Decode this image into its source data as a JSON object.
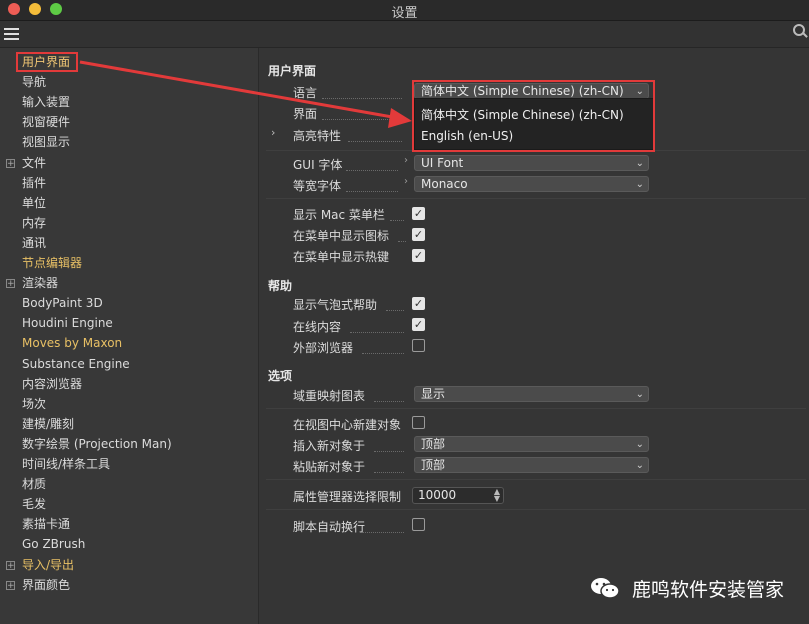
{
  "window": {
    "title": "设置"
  },
  "sidebar": {
    "items": [
      {
        "label": "用户界面",
        "state": "selected"
      },
      {
        "label": "导航"
      },
      {
        "label": "输入装置"
      },
      {
        "label": "视窗硬件"
      },
      {
        "label": "视图显示"
      },
      {
        "label": "文件",
        "expandable": true
      },
      {
        "label": "插件"
      },
      {
        "label": "单位"
      },
      {
        "label": "内存"
      },
      {
        "label": "通讯"
      },
      {
        "label": "节点编辑器",
        "state": "highlight"
      },
      {
        "label": "渲染器",
        "expandable": true
      },
      {
        "label": "BodyPaint 3D"
      },
      {
        "label": "Houdini Engine"
      },
      {
        "label": "Moves by Maxon",
        "state": "highlight"
      },
      {
        "label": "Substance Engine"
      },
      {
        "label": "内容浏览器"
      },
      {
        "label": "场次"
      },
      {
        "label": "建模/雕刻"
      },
      {
        "label": "数字绘景 (Projection Man)"
      },
      {
        "label": "时间线/样条工具"
      },
      {
        "label": "材质"
      },
      {
        "label": "毛发"
      },
      {
        "label": "素描卡通"
      },
      {
        "label": "Go ZBrush"
      },
      {
        "label": "导入/导出",
        "expandable": true,
        "state": "highlight"
      },
      {
        "label": "界面颜色",
        "expandable": true
      }
    ]
  },
  "main": {
    "section_ui": "用户界面",
    "language_label": "语言",
    "language_value": "简体中文 (Simple Chinese) (zh-CN)",
    "interface_label": "界面",
    "highlight_label": "高亮特性",
    "gui_font_label": "GUI 字体",
    "gui_font_value": "UI Font",
    "mono_font_label": "等宽字体",
    "mono_font_value": "Monaco",
    "show_mac_menubar": "显示 Mac 菜单栏",
    "show_icons_in_menu": "在菜单中显示图标",
    "show_hotkeys_in_menu": "在菜单中显示热键",
    "section_help": "帮助",
    "show_bubble_help": "显示气泡式帮助",
    "online_content": "在线内容",
    "external_browser": "外部浏览器",
    "section_options": "选项",
    "field_map_label": "域重映射图表",
    "field_map_value": "显示",
    "new_object_view_center": "在视图中心新建对象",
    "insert_new_object_label": "插入新对象于",
    "insert_new_object_value": "顶部",
    "paste_new_object_label": "粘贴新对象于",
    "paste_new_object_value": "顶部",
    "attr_manager_limit_label": "属性管理器选择限制",
    "attr_manager_limit_value": "10000",
    "script_auto_wrap": "脚本自动换行"
  },
  "language_popup": {
    "options": [
      "简体中文 (Simple Chinese) (zh-CN)",
      "English (en-US)"
    ]
  },
  "checkboxes": {
    "show_mac_menubar": true,
    "show_icons_in_menu": true,
    "show_hotkeys_in_menu": true,
    "show_bubble_help": true,
    "online_content": true,
    "external_browser": false,
    "new_object_view_center": false,
    "script_auto_wrap": false
  },
  "watermark": {
    "text": "鹿鸣软件安装管家"
  },
  "colors": {
    "annotation_red": "#e23a3a",
    "highlight_text": "#e8c065"
  }
}
